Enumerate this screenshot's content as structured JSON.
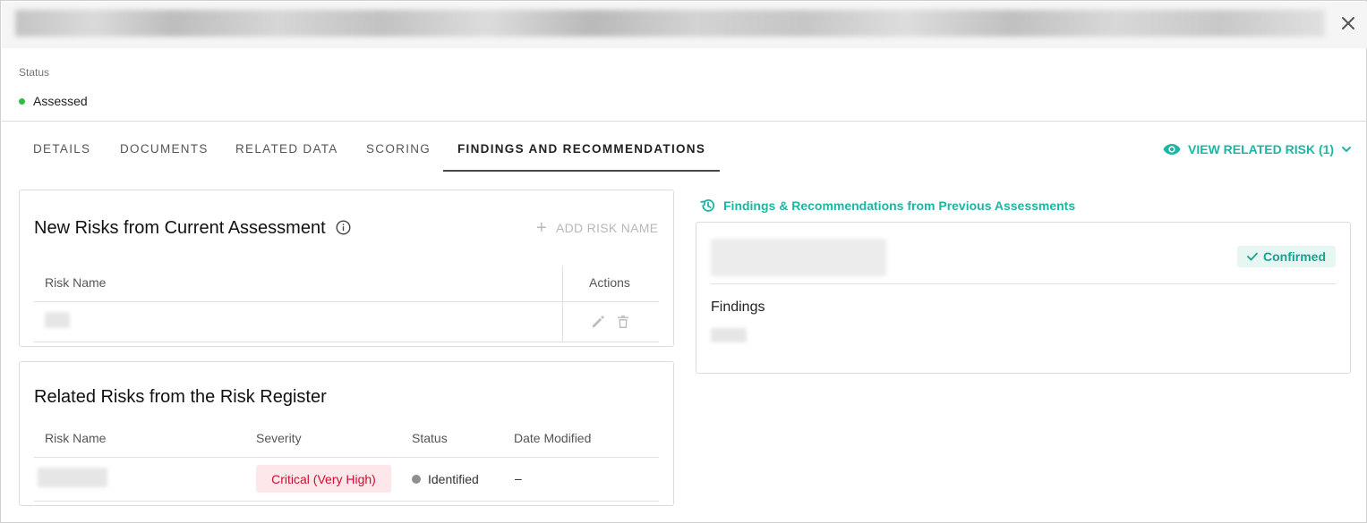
{
  "status": {
    "label": "Status",
    "value": "Assessed",
    "color": "#2ebd3f"
  },
  "icons": {
    "close": "close-icon",
    "eye": "eye-icon",
    "chevron": "chevron-down-icon",
    "info": "info-icon",
    "plus": "plus-icon",
    "edit": "pencil-icon",
    "delete": "trash-icon",
    "history": "history-icon",
    "check": "check-icon"
  },
  "tabs": [
    {
      "label": "DETAILS"
    },
    {
      "label": "DOCUMENTS"
    },
    {
      "label": "RELATED DATA"
    },
    {
      "label": "SCORING"
    },
    {
      "label": "FINDINGS AND RECOMMENDATIONS",
      "active": true
    }
  ],
  "view_related": {
    "label": "VIEW RELATED RISK (1)",
    "color": "#1db5a3"
  },
  "new_risks": {
    "title": "New Risks from Current Assessment",
    "add_label": "ADD RISK NAME",
    "columns": [
      "Risk Name",
      "Actions"
    ]
  },
  "related_risks": {
    "title": "Related Risks from the Risk Register",
    "columns": [
      "Risk Name",
      "Severity",
      "Status",
      "Date Modified"
    ],
    "rows": [
      {
        "severity": "Critical (Very High)",
        "status": "Identified",
        "date_modified": "–"
      }
    ],
    "severity_color": "#c8102e"
  },
  "previous": {
    "heading": "Findings & Recommendations from Previous Assessments",
    "badge": "Confirmed",
    "findings_label": "Findings"
  }
}
